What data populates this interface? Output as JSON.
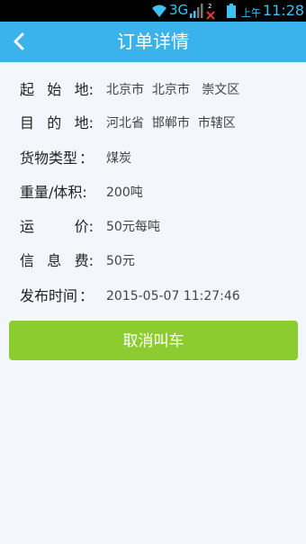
{
  "status_bar": {
    "network": "3G",
    "ampm": "上午",
    "time": "11:28"
  },
  "header": {
    "title": "订单详情",
    "bg_color": "#3ab3ec"
  },
  "details": [
    {
      "label": "起始地:",
      "label_chars": [
        "起",
        "始",
        "地:"
      ],
      "value": "北京市  北京市   崇文区"
    },
    {
      "label": "目的地:",
      "label_chars": [
        "目",
        "的",
        "地:"
      ],
      "value": "河北省  邯郸市  市辖区"
    },
    {
      "label": "货物类型：",
      "label_chars": [
        "货物类型",
        "："
      ],
      "value": "煤炭"
    },
    {
      "label": "重量/体积:",
      "label_chars": [
        "重量/体积:"
      ],
      "value": "200吨"
    },
    {
      "label": "运价:",
      "label_chars": [
        "运",
        "价:"
      ],
      "value": "50元每吨"
    },
    {
      "label": "信息费:",
      "label_chars": [
        "信",
        "息",
        "费:"
      ],
      "value": "50元"
    },
    {
      "label": "发布时间：",
      "label_chars": [
        "发布时间",
        "："
      ],
      "value": "2015-05-07 11:27:46"
    }
  ],
  "actions": {
    "cancel_label": "取消叫车",
    "cancel_color": "#8ccc2f"
  }
}
